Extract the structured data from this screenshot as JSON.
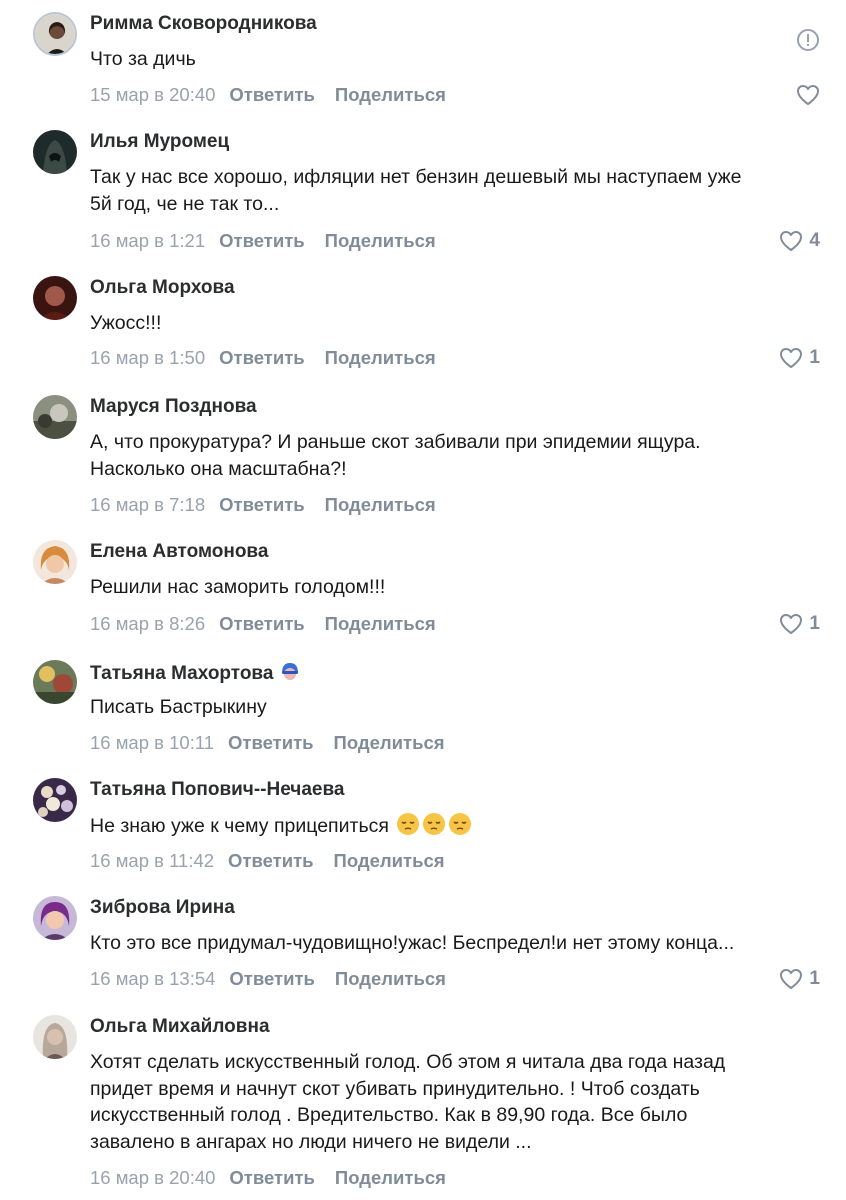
{
  "comments": [
    {
      "author": "Римма Сковородникова",
      "text": [
        "Что за дичь"
      ],
      "date": "15 мар в 20:40",
      "reply": "Ответить",
      "share": "Поделиться",
      "likes": ""
    },
    {
      "author": "Илья Муромец",
      "text": [
        "Так у нас все хорошо, ифляции нет бензин дешевый мы наступаем уже",
        "5й год, че не так то..."
      ],
      "date": "16 мар в 1:21",
      "reply": "Ответить",
      "share": "Поделиться",
      "likes": "4"
    },
    {
      "author": "Ольга Морхова",
      "text": [
        "Ужосс!!!"
      ],
      "date": "16 мар в 1:50",
      "reply": "Ответить",
      "share": "Поделиться",
      "likes": "1"
    },
    {
      "author": "Маруся Позднова",
      "text": [
        "А, что прокуратура? И раньше скот забивали при эпидемии ящура.",
        "Насколько она масштабна?!"
      ],
      "date": "16 мар в 7:18",
      "reply": "Ответить",
      "share": "Поделиться",
      "likes": ""
    },
    {
      "author": "Елена Автомонова",
      "text": [
        "Решили нас заморить голодом!!!"
      ],
      "date": "16 мар в 8:26",
      "reply": "Ответить",
      "share": "Поделиться",
      "likes": "1"
    },
    {
      "author": "Татьяна Махортова",
      "text": [
        "Писать Бастрыкину"
      ],
      "date": "16 мар в 10:11",
      "reply": "Ответить",
      "share": "Поделиться",
      "likes": ""
    },
    {
      "author": "Татьяна Попович--Нечаева",
      "text": [
        "Не знаю уже к чему прицепиться"
      ],
      "date": "16 мар в 11:42",
      "reply": "Ответить",
      "share": "Поделиться",
      "likes": ""
    },
    {
      "author": "Зиброва Ирина",
      "text": [
        "Кто это все придумал-чудовищно!ужас! Беспредел!и нет этому конца..."
      ],
      "date": "16 мар в 13:54",
      "reply": "Ответить",
      "share": "Поделиться",
      "likes": "1"
    },
    {
      "author": "Ольга Михайловна",
      "text": [
        "Хотят сделать искусственный голод. Об этом я читала два года назад",
        "придет время и начнут скот убивать принудительно. ! Чтоб создать",
        "искусственный голод . Вредительство. Как в 89,90 года. Все было",
        "завалено в ангарах но люди ничего не видели ..."
      ],
      "date": "16 мар в 20:40",
      "reply": "Ответить",
      "share": "Поделиться",
      "likes": ""
    }
  ],
  "colors": {
    "text": "#1a1a1a",
    "author": "#2c2d2e",
    "meta": "#818c99",
    "date": "#99a2ad"
  },
  "icons": {
    "like": "heart-outline-icon",
    "report": "exclamation-circle-icon",
    "emoji": "pensive-face-emoji",
    "badge": "blue-hat-emoji"
  }
}
